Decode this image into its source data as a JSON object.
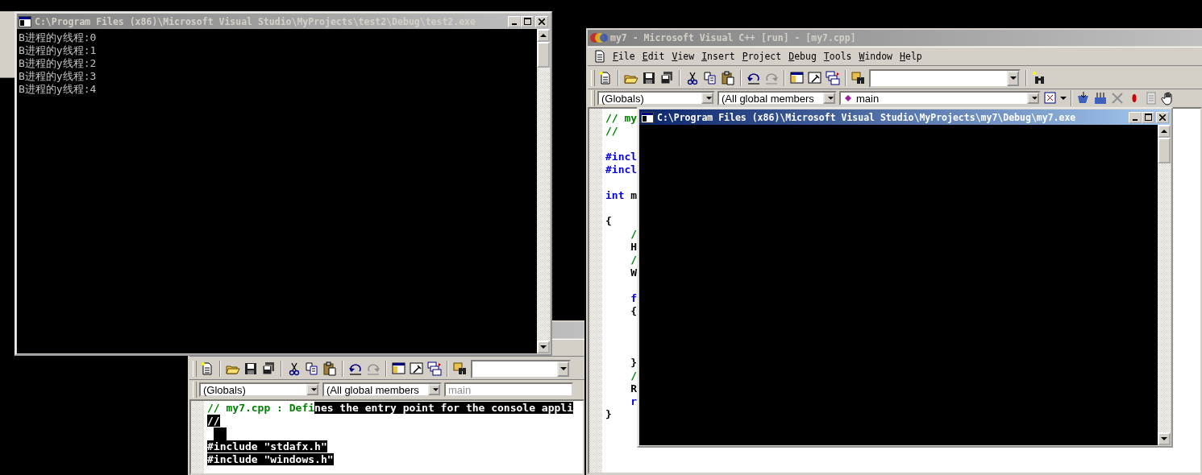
{
  "ide_windows": [
    {
      "kind": "back",
      "combos": [
        {
          "text": "(Globals)",
          "disabled": false
        },
        {
          "text": "(All global members",
          "disabled": false
        },
        {
          "text": "main",
          "disabled": true
        }
      ],
      "code_lines": [
        {
          "kind": "code",
          "segments": [
            {
              "text": "// my7.cpp : Defi",
              "kind": "comment",
              "selected": false
            },
            {
              "text": "nes the entry point for the console appli",
              "kind": "plain",
              "selected": true
            }
          ]
        },
        {
          "kind": "code",
          "segments": [
            {
              "text": "//",
              "kind": "comment",
              "selected": true
            }
          ]
        },
        {
          "kind": "blank",
          "selected": true
        },
        {
          "kind": "code",
          "segments": [
            {
              "text": "#include \"stdafx.h\"",
              "kind": "keyword",
              "selected": true
            }
          ]
        },
        {
          "kind": "code",
          "segments": [
            {
              "text": "#include \"windows.h\"",
              "kind": "keyword",
              "selected": true
            }
          ]
        }
      ]
    },
    {
      "kind": "main",
      "title": "my7 - Microsoft Visual C++ [run] - [my7.cpp]",
      "menu": [
        "File",
        "Edit",
        "View",
        "Insert",
        "Project",
        "Debug",
        "Tools",
        "Window",
        "Help"
      ],
      "combos": [
        {
          "text": "(Globals)",
          "disabled": false
        },
        {
          "text": "(All global members",
          "disabled": false
        },
        {
          "text": "main",
          "disabled": false
        }
      ],
      "code_lines": [
        {
          "kind": "code",
          "segments": [
            {
              "text": "// my",
              "kind": "comment"
            }
          ]
        },
        {
          "kind": "code",
          "segments": [
            {
              "text": "//",
              "kind": "comment"
            }
          ]
        },
        {
          "kind": "blank"
        },
        {
          "kind": "code",
          "segments": [
            {
              "text": "#incl",
              "kind": "keyword"
            }
          ]
        },
        {
          "kind": "code",
          "segments": [
            {
              "text": "#incl",
              "kind": "keyword"
            }
          ]
        },
        {
          "kind": "blank"
        },
        {
          "kind": "code",
          "segments": [
            {
              "text": "int",
              "kind": "keyword"
            },
            {
              "text": " m",
              "kind": "plain"
            }
          ]
        },
        {
          "kind": "blank"
        },
        {
          "kind": "code",
          "segments": [
            {
              "text": "{",
              "kind": "plain"
            }
          ]
        },
        {
          "kind": "code",
          "segments": [
            {
              "text": "    /",
              "kind": "comment"
            }
          ]
        },
        {
          "kind": "code",
          "segments": [
            {
              "text": "    H",
              "kind": "plain"
            }
          ]
        },
        {
          "kind": "code",
          "segments": [
            {
              "text": "    /",
              "kind": "comment"
            }
          ]
        },
        {
          "kind": "code",
          "segments": [
            {
              "text": "    W",
              "kind": "plain"
            }
          ]
        },
        {
          "kind": "blank"
        },
        {
          "kind": "code",
          "segments": [
            {
              "text": "    f",
              "kind": "keyword"
            }
          ]
        },
        {
          "kind": "code",
          "segments": [
            {
              "text": "    {",
              "kind": "plain"
            }
          ]
        },
        {
          "kind": "blank"
        },
        {
          "kind": "blank"
        },
        {
          "kind": "blank"
        },
        {
          "kind": "code",
          "segments": [
            {
              "text": "    }",
              "kind": "plain"
            }
          ]
        },
        {
          "kind": "code",
          "segments": [
            {
              "text": "    /",
              "kind": "comment"
            }
          ]
        },
        {
          "kind": "code",
          "segments": [
            {
              "text": "    R",
              "kind": "plain"
            }
          ]
        },
        {
          "kind": "code",
          "segments": [
            {
              "text": "    r",
              "kind": "keyword"
            }
          ]
        },
        {
          "kind": "code",
          "segments": [
            {
              "text": "}",
              "kind": "plain"
            }
          ]
        }
      ]
    }
  ],
  "console_windows": [
    {
      "title": "C:\\Program Files (x86)\\Microsoft Visual Studio\\MyProjects\\test2\\Debug\\test2.exe",
      "active": false,
      "lines": [
        "B进程的y线程:0",
        "B进程的y线程:1",
        "B进程的y线程:2",
        "B进程的y线程:3",
        "B进程的y线程:4"
      ]
    },
    {
      "title": "C:\\Program Files (x86)\\Microsoft Visual Studio\\MyProjects\\my7\\Debug\\my7.exe",
      "active": true
    }
  ]
}
